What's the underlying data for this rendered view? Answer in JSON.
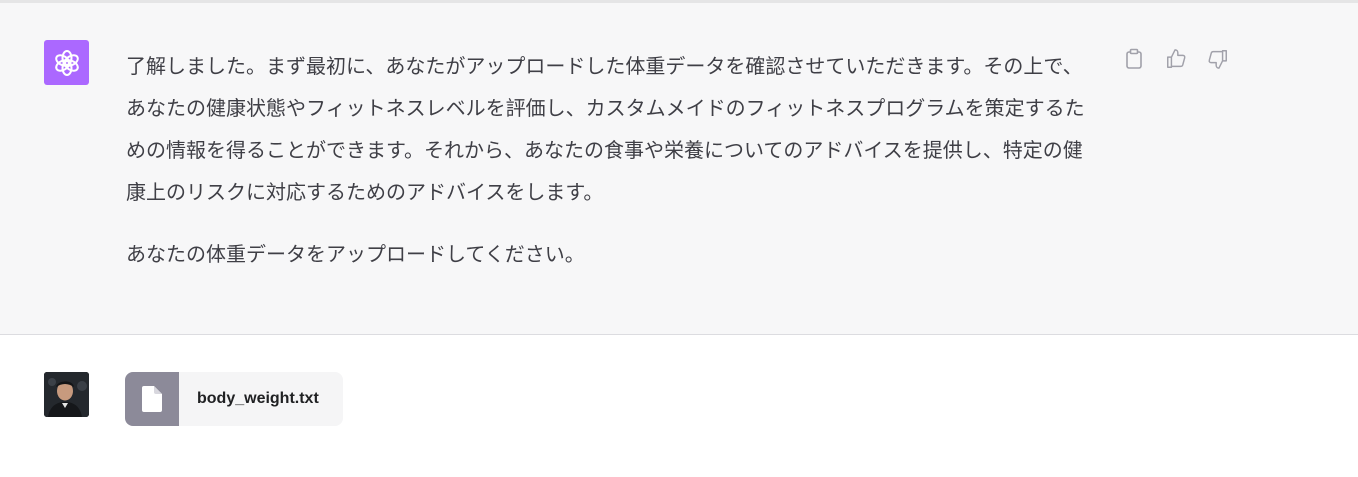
{
  "assistant": {
    "paragraphs": [
      "了解しました。まず最初に、あなたがアップロードした体重データを確認させていただきます。その上で、あなたの健康状態やフィットネスレベルを評価し、カスタムメイドのフィットネスプログラムを策定するための情報を得ることができます。それから、あなたの食事や栄養についてのアドバイスを提供し、特定の健康上のリスクに対応するためのアドバイスをします。",
      "あなたの体重データをアップロードしてください。"
    ],
    "avatar_icon": "openai-logo-icon",
    "avatar_color": "#ab68ff",
    "actions": [
      "copy-icon",
      "thumbs-up-icon",
      "thumbs-down-icon"
    ]
  },
  "user": {
    "avatar": "user-photo",
    "attachment": {
      "file_name": "body_weight.txt",
      "icon": "file-icon"
    }
  },
  "colors": {
    "assistant_bg": "#f7f7f8",
    "file_icon_bg": "#8c8a99"
  }
}
